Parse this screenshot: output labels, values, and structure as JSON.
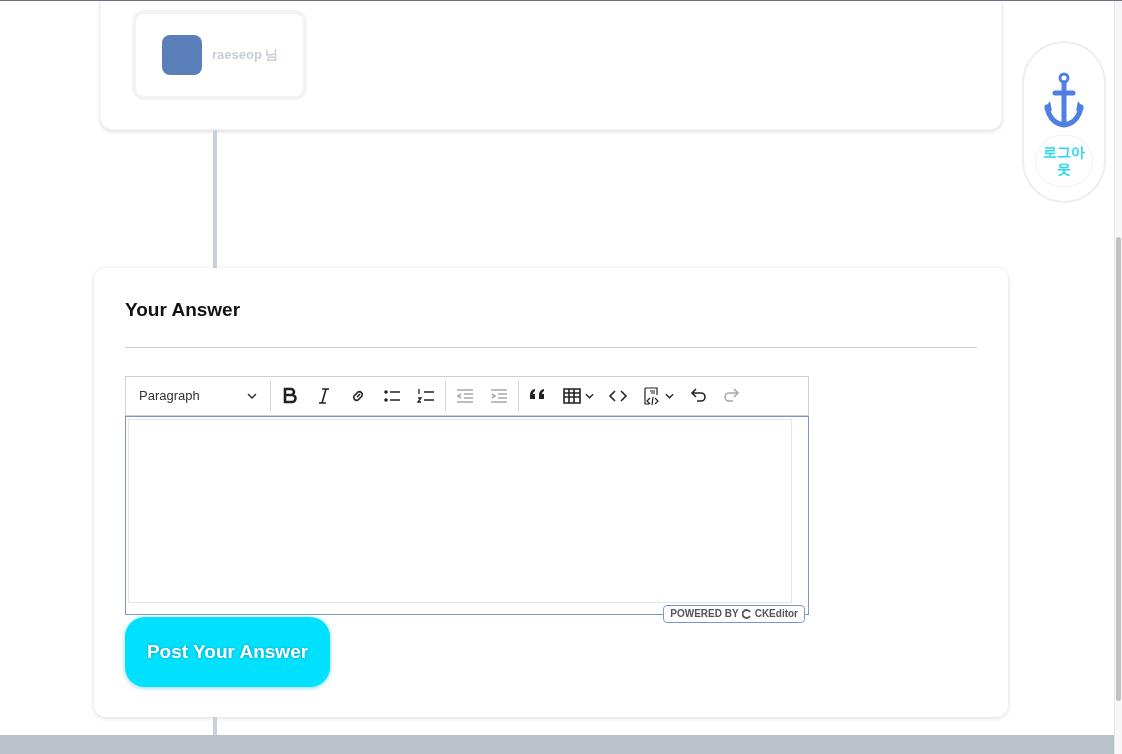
{
  "user_card": {
    "name": "raeseop 님"
  },
  "side_widget": {
    "label": "로그아웃"
  },
  "answer": {
    "title": "Your Answer",
    "toolbar": {
      "format": "Paragraph",
      "buttons": [
        {
          "disabled": false
        },
        {
          "disabled": false
        },
        {
          "disabled": false
        },
        {
          "disabled": false
        },
        {
          "disabled": false
        },
        {
          "disabled": true
        },
        {
          "disabled": true
        },
        {
          "disabled": false
        },
        {
          "disabled": false
        },
        {
          "disabled": false
        },
        {
          "disabled": false
        },
        {
          "disabled": false
        },
        {
          "disabled": true
        }
      ]
    },
    "powered_by": "POWERED BY",
    "brand": "CKEditor",
    "submit": "Post Your Answer"
  }
}
